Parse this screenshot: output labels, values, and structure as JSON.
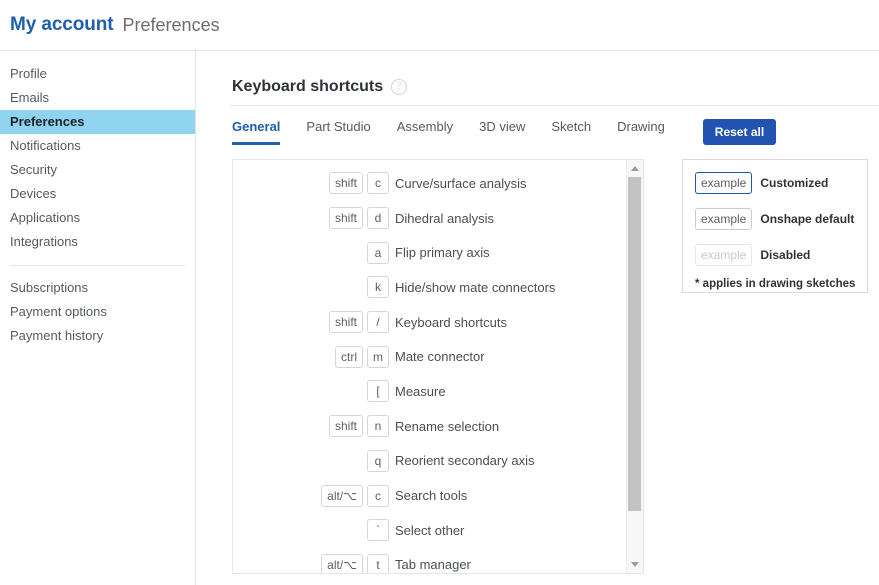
{
  "header": {
    "account_title": "My account",
    "page_subtitle": "Preferences"
  },
  "sidebar": {
    "group_one": [
      {
        "label": "Profile",
        "active": false
      },
      {
        "label": "Emails",
        "active": false
      },
      {
        "label": "Preferences",
        "active": true
      },
      {
        "label": "Notifications",
        "active": false
      },
      {
        "label": "Security",
        "active": false
      },
      {
        "label": "Devices",
        "active": false
      },
      {
        "label": "Applications",
        "active": false
      },
      {
        "label": "Integrations",
        "active": false
      }
    ],
    "group_two": [
      {
        "label": "Subscriptions"
      },
      {
        "label": "Payment options"
      },
      {
        "label": "Payment history"
      }
    ]
  },
  "main": {
    "section_title": "Keyboard shortcuts",
    "help_icon_glyph": "?",
    "tabs": [
      {
        "label": "General",
        "active": true
      },
      {
        "label": "Part Studio",
        "active": false
      },
      {
        "label": "Assembly",
        "active": false
      },
      {
        "label": "3D view",
        "active": false
      },
      {
        "label": "Sketch",
        "active": false
      },
      {
        "label": "Drawing",
        "active": false
      }
    ],
    "reset_all_label": "Reset all"
  },
  "shortcuts": [
    {
      "keys": [
        "shift",
        "c"
      ],
      "label": "Curve/surface analysis"
    },
    {
      "keys": [
        "shift",
        "d"
      ],
      "label": "Dihedral analysis"
    },
    {
      "keys": [
        "a"
      ],
      "label": "Flip primary axis"
    },
    {
      "keys": [
        "k"
      ],
      "label": "Hide/show mate connectors"
    },
    {
      "keys": [
        "shift",
        "/"
      ],
      "label": "Keyboard shortcuts"
    },
    {
      "keys": [
        "ctrl",
        "m"
      ],
      "label": "Mate connector"
    },
    {
      "keys": [
        "["
      ],
      "label": "Measure"
    },
    {
      "keys": [
        "shift",
        "n"
      ],
      "label": "Rename selection"
    },
    {
      "keys": [
        "q"
      ],
      "label": "Reorient secondary axis"
    },
    {
      "keys": [
        "alt/⌥",
        "c"
      ],
      "label": "Search tools"
    },
    {
      "keys": [
        "`"
      ],
      "label": "Select other"
    },
    {
      "keys": [
        "alt/⌥",
        "t"
      ],
      "label": "Tab manager"
    }
  ],
  "legend": {
    "rows": [
      {
        "chip": "example",
        "label": "Customized",
        "style": "customized"
      },
      {
        "chip": "example",
        "label": "Onshape default",
        "style": "default"
      },
      {
        "chip": "example",
        "label": "Disabled",
        "style": "disabled"
      }
    ],
    "note": "* applies in drawing sketches"
  },
  "colors": {
    "brand_blue": "#1f5fad",
    "button_blue": "#2353b0",
    "active_nav_bg": "#8fd3ef",
    "border_gray": "#e2e5e8"
  }
}
